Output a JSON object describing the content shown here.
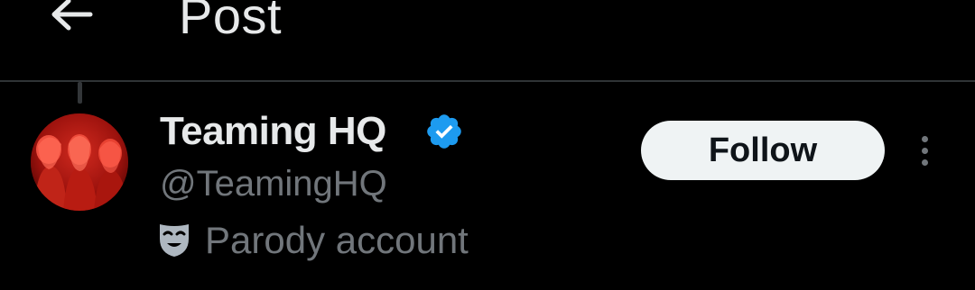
{
  "header": {
    "back_icon": "arrow-left-icon",
    "title": "Post"
  },
  "post": {
    "author": {
      "display_name": "Teaming HQ",
      "handle": "@TeamingHQ",
      "verified": true,
      "verified_icon": "verified-badge-icon",
      "avatar_icon": "avatar-image",
      "label_icon": "parody-mask-icon",
      "label": "Parody account"
    },
    "follow_label": "Follow",
    "more_icon": "more-vertical-icon"
  },
  "colors": {
    "background": "#000000",
    "primary_text": "#e7e9ea",
    "secondary_text": "#71767b",
    "divider": "#2f3336",
    "verified_blue": "#1d9bf0",
    "follow_bg": "#eff3f4",
    "follow_text": "#0f1419",
    "avatar_red": "#c0201a"
  }
}
